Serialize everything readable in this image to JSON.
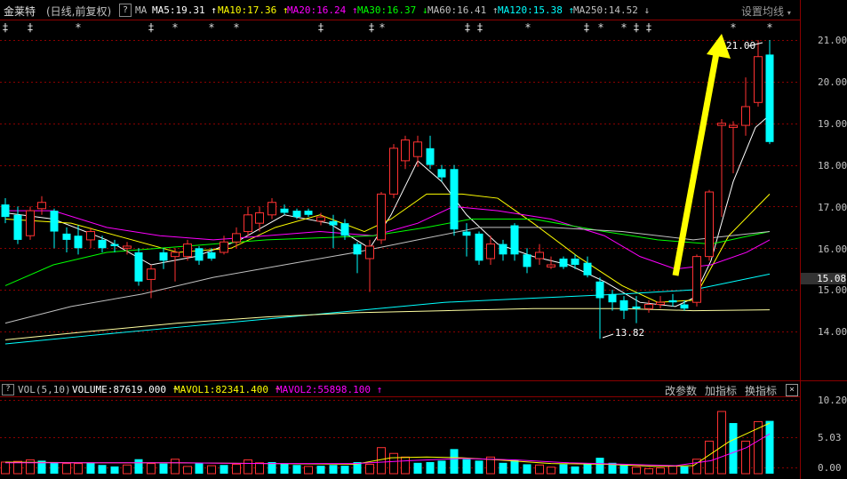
{
  "header": {
    "stock_name": "金莱特",
    "period": "(日线,前复权)",
    "help": "?",
    "ma_label": "MA",
    "ma_items": [
      {
        "text": "MA5:19.31",
        "arrow": "↑",
        "color": "#ffffff"
      },
      {
        "text": "MA10:17.36",
        "arrow": "↑",
        "color": "#ffff00"
      },
      {
        "text": "MA20:16.24",
        "arrow": "↑",
        "color": "#ff00ff"
      },
      {
        "text": "MA30:16.37",
        "arrow": "↓",
        "color": "#00ff00"
      },
      {
        "text": "MA60:16.41",
        "arrow": "↑",
        "color": "#c0c0c0"
      },
      {
        "text": "MA120:15.38",
        "arrow": "↑",
        "color": "#00ffff"
      },
      {
        "text": "MA250:14.52",
        "arrow": "↓",
        "color": "#c0c0c0"
      }
    ],
    "settings": "设置均线"
  },
  "price_axis": {
    "labels": [
      "21.00",
      "20.00",
      "19.00",
      "18.00",
      "17.00",
      "16.00",
      "15.00",
      "14.00"
    ],
    "current_price": "15.08"
  },
  "annotations": {
    "high": "21.00",
    "low": "13.82"
  },
  "volume_header": {
    "indicator": "VOL(5,10)",
    "volume": "VOLUME:87619.000",
    "volume_arrow": "↑",
    "mavol1": "MAVOL1:82341.400",
    "mavol1_arrow": "↑",
    "mavol2": "MAVOL2:55898.100",
    "mavol2_arrow": "↑",
    "buttons": [
      "改参数",
      "加指标",
      "换指标"
    ],
    "close": "×"
  },
  "volume_axis": {
    "labels": [
      "10.20",
      "5.03",
      "0.00"
    ]
  },
  "colors": {
    "up": "#ff3232",
    "down": "#00ffff",
    "ma5": "#ffffff",
    "ma10": "#ffff00",
    "ma20": "#ff00ff",
    "ma30": "#00ff00",
    "ma60": "#c0c0c0",
    "ma120": "#00ffff",
    "ma250": "#ffffa0",
    "arrow": "#ffff00",
    "grid": "#8b0000"
  }
}
